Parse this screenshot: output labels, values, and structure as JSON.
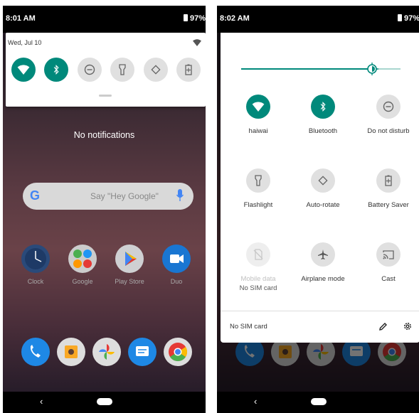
{
  "left": {
    "status": {
      "time": "8:01 AM",
      "battery": "97%"
    },
    "quick_settings": {
      "date": "Wed, Jul 10"
    },
    "notifications_text": "No notifications",
    "search": {
      "text": "Say \"Hey Google\""
    },
    "apps": [
      {
        "label": "Clock"
      },
      {
        "label": "Google"
      },
      {
        "label": "Play Store"
      },
      {
        "label": "Duo"
      }
    ]
  },
  "right": {
    "status": {
      "time": "8:02 AM",
      "battery": "97%"
    },
    "brightness": 0.82,
    "tiles": [
      {
        "label": "haiwai",
        "state": "on",
        "icon": "wifi-icon"
      },
      {
        "label": "Bluetooth",
        "state": "on",
        "icon": "bluetooth-icon"
      },
      {
        "label": "Do not disturb",
        "state": "off",
        "icon": "do-not-disturb-icon"
      },
      {
        "label": "Flashlight",
        "state": "off",
        "icon": "flashlight-icon"
      },
      {
        "label": "Auto-rotate",
        "state": "off",
        "icon": "auto-rotate-icon"
      },
      {
        "label": "Battery Saver",
        "state": "off",
        "icon": "battery-saver-icon"
      },
      {
        "label": "Mobile data",
        "sublabel": "No SIM card",
        "state": "disabled",
        "icon": "mobile-data-off-icon"
      },
      {
        "label": "Airplane mode",
        "state": "off",
        "icon": "airplane-icon"
      },
      {
        "label": "Cast",
        "state": "off",
        "icon": "cast-icon"
      }
    ],
    "footer": {
      "sim_status": "No SIM card"
    }
  },
  "colors": {
    "accent": "#00897b",
    "tile_off": "#e0e0e0"
  }
}
